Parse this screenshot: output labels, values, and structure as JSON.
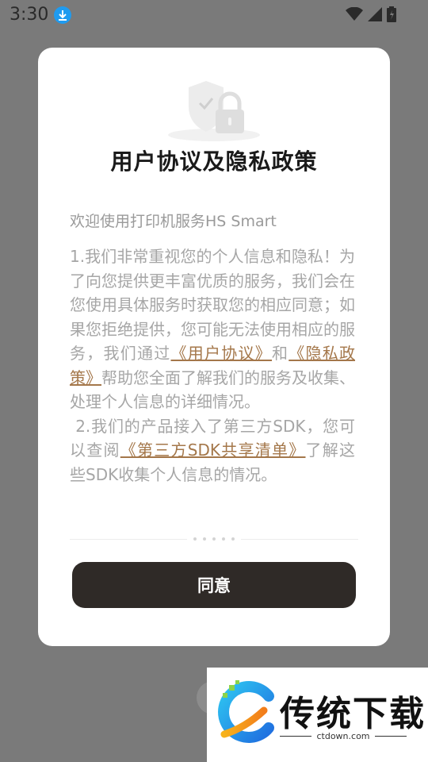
{
  "status_bar": {
    "time": "3:30"
  },
  "dialog": {
    "title": "用户协议及隐私政策",
    "welcome": "欢迎使用打印机服务HS Smart",
    "para1_a": "1.我们非常重视您的个人信息和隐私！为了向您提供更丰富优质的服务，我们会在您使用具体服务时获取您的相应同意；如果您拒绝提供，您可能无法使用相应的服务，我们通过",
    "link_user_agreement": "《用户协议》",
    "para1_and": "和",
    "link_privacy_policy": "《隐私政策》",
    "para1_b": "帮助您全面了解我们的服务及收集、处理个人信息的详细情况。",
    "para2_a": "2.我们的产品接入了第三方SDK，您可以查阅",
    "link_sdk_list": "《第三方SDK共享清单》",
    "para2_b": "了解这些SDK收集个人信息的情况。",
    "agree_label": "同意",
    "link_color": "#a4774a",
    "button_color": "#2f2a27"
  },
  "watermark": {
    "title": "传统下载",
    "url": "ctdown.com"
  }
}
